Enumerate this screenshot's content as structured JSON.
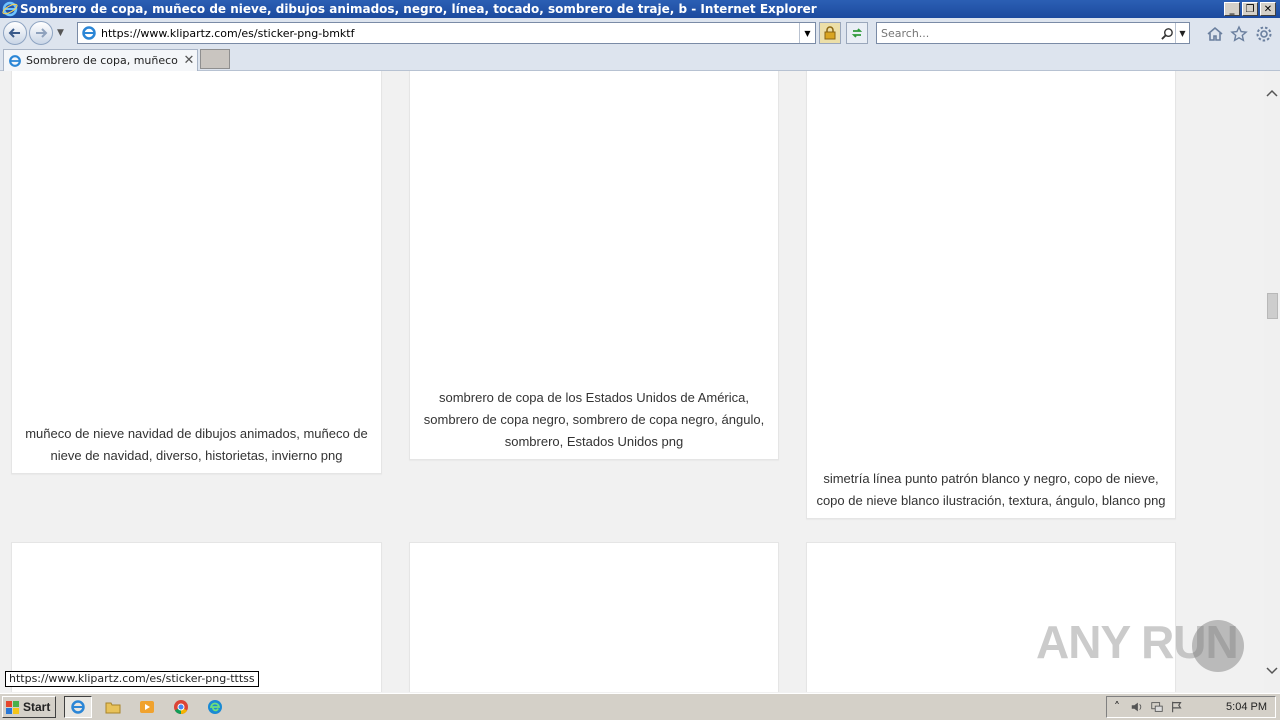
{
  "window": {
    "title": "Sombrero de copa, muñeco de nieve, dibujos animados, negro, línea, tocado, sombrero de traje, b - Internet Explorer",
    "buttons": {
      "minimize": "_",
      "maximize": "❐",
      "close": "✕"
    }
  },
  "navbar": {
    "url": "https://www.klipartz.com/es/sticker-png-bmktf",
    "search_placeholder": "Search..."
  },
  "tab": {
    "label": "Sombrero de copa, muñeco ...",
    "close": "✕"
  },
  "cards": [
    {
      "caption": "muñeco de nieve navidad de dibujos animados, muñeco de nieve de navidad, diverso, historietas, invierno png"
    },
    {
      "caption": "sombrero de copa de los Estados Unidos de América, sombrero de copa negro, sombrero de copa negro, ángulo, sombrero, Estados Unidos png"
    },
    {
      "caption": "simetría línea punto patrón blanco y negro, copo de nieve, copo de nieve blanco ilustración, textura, ángulo, blanco png"
    }
  ],
  "status_url": "https://www.klipartz.com/es/sticker-png-tttss",
  "watermark": "ANY RUN",
  "taskbar": {
    "start_label": "Start",
    "clock": "5:04 PM"
  },
  "colors": {
    "titlebar": "#1c4a9e",
    "navbar": "#dde4ee",
    "page_bg": "#f1f1f1",
    "card_bg": "#ffffff"
  }
}
